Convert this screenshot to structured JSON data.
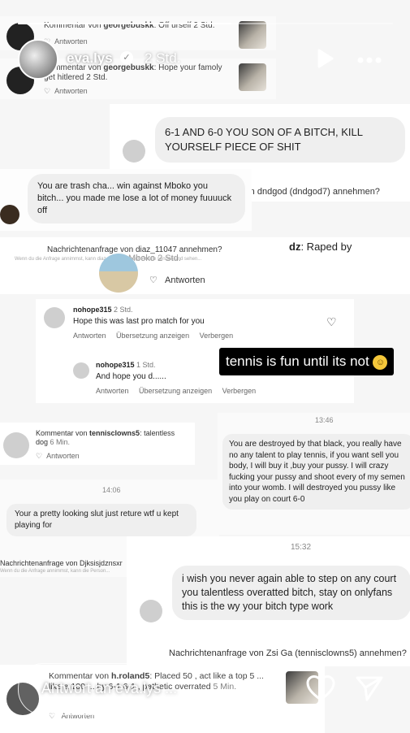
{
  "story": {
    "username": "eva.lys",
    "time_ago": "2 Std.",
    "progress": 0.57,
    "sticker_text": "tennis is fun until its not"
  },
  "comments_top": [
    {
      "prefix": "Kommentar von",
      "user": "georgebuskk",
      "text": ": Off urself",
      "time": "2 Std.",
      "reply": "Antworten"
    },
    {
      "prefix": "Kommentar von",
      "user": "georgebuskk",
      "text": ": Hope your famoly get hitlered",
      "time": "2 Std.",
      "reply": "Antworten"
    }
  ],
  "dm1": {
    "message": "6-1 AND 6-0 YOU SON OF A BITCH, KILL YOURSELF PIECE OF SHIT",
    "request": "Nachrichtenanfrage von dndgod (dndgod7) annehmen?"
  },
  "dm2": {
    "message": "You are trash cha... win against Mboko you bitch... you made me lose a lot of money fuuuuck off"
  },
  "dm3": {
    "request": "Nachrichtenanfrage von diaz_11047 annehmen?",
    "request_sub": "Wenn du die Anfrage annimmst, kann diaz_11047 dir auch Anrufe senden und sehen...",
    "partial_user": "dz",
    "partial_text": ": Raped by",
    "partial_caption": "Mboko 2 Std.",
    "reply": "Antworten"
  },
  "thread": {
    "user1": "nohope315",
    "time1": "2 Std.",
    "text1": "Hope this was last pro match for you",
    "user2": "nohope315",
    "time2": "1 Std.",
    "text2": "And hope you d......",
    "actions": [
      "Antworten",
      "Übersetzung anzeigen",
      "Verbergen"
    ]
  },
  "tennisclowns": {
    "prefix": "Kommentar von",
    "user": "tennisclowns5",
    "text": ": talentless dog",
    "time": "6 Min.",
    "reply": "Antworten"
  },
  "dm4": {
    "time": "13:46",
    "message": "You are destroyed by that black, you really have no any talent to play tennis, if you want sell you body, I will buy it ,buy your pussy.  I will crazy fucking your pussy and shoot every of my semen into your womb. I will destroyed you pussy like you play on court 6-0"
  },
  "dm5": {
    "time": "14:06",
    "message": "Your a pretty looking slut just reture wtf u kept playing for",
    "request": "Nachrichtenanfrage von Djksisjdznsxr",
    "request_sub": "Wenn du die Anfrage annimmst, kann die Person..."
  },
  "dm6": {
    "time": "15:32",
    "message": "i wish you never again able to step on any court you talentless overatted bitch, stay on onlyfans this is the wy your bitch type work",
    "request": "Nachrichtenanfrage von Zsi Ga (tennisclowns5) annehmen?"
  },
  "roland": {
    "prefix": "Kommentar von",
    "user": "h.roland5",
    "text": ": Placed 50 , act like a top 5 ... like a 100 ... by 6-1 6-1 , pathetic overrated",
    "time": "5 Min.",
    "reply": "Antworten"
  },
  "reply_bar": {
    "placeholder": "Antwort an eva.lys ..."
  }
}
